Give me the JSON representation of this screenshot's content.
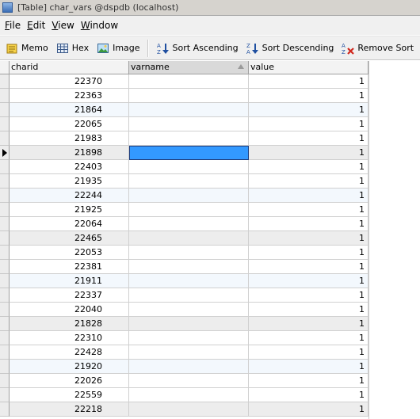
{
  "window": {
    "title": "[Table] char_vars @dspdb (localhost)"
  },
  "menu": {
    "items": [
      {
        "u": "F",
        "rest": "ile"
      },
      {
        "u": "E",
        "rest": "dit"
      },
      {
        "u": "V",
        "rest": "iew"
      },
      {
        "u": "W",
        "rest": "indow"
      }
    ]
  },
  "toolbar": {
    "memo": "Memo",
    "hex": "Hex",
    "image": "Image",
    "sort_asc": "Sort Ascending",
    "sort_desc": "Sort Descending",
    "remove_sort": "Remove Sort"
  },
  "table": {
    "columns": [
      "charid",
      "varname",
      "value"
    ],
    "sorted_column": "varname",
    "rows": [
      {
        "charid": "22370",
        "varname": "",
        "value": "1"
      },
      {
        "charid": "22363",
        "varname": "",
        "value": "1"
      },
      {
        "charid": "21864",
        "varname": "",
        "value": "1"
      },
      {
        "charid": "22065",
        "varname": "",
        "value": "1"
      },
      {
        "charid": "21983",
        "varname": "",
        "value": "1"
      },
      {
        "charid": "21898",
        "varname": "",
        "value": "1"
      },
      {
        "charid": "22403",
        "varname": "",
        "value": "1"
      },
      {
        "charid": "21935",
        "varname": "",
        "value": "1"
      },
      {
        "charid": "22244",
        "varname": "",
        "value": "1"
      },
      {
        "charid": "21925",
        "varname": "",
        "value": "1"
      },
      {
        "charid": "22064",
        "varname": "",
        "value": "1"
      },
      {
        "charid": "22465",
        "varname": "",
        "value": "1"
      },
      {
        "charid": "22053",
        "varname": "",
        "value": "1"
      },
      {
        "charid": "22381",
        "varname": "",
        "value": "1"
      },
      {
        "charid": "21911",
        "varname": "",
        "value": "1"
      },
      {
        "charid": "22337",
        "varname": "",
        "value": "1"
      },
      {
        "charid": "22040",
        "varname": "",
        "value": "1"
      },
      {
        "charid": "21828",
        "varname": "",
        "value": "1"
      },
      {
        "charid": "22310",
        "varname": "",
        "value": "1"
      },
      {
        "charid": "22428",
        "varname": "",
        "value": "1"
      },
      {
        "charid": "21920",
        "varname": "",
        "value": "1"
      },
      {
        "charid": "22026",
        "varname": "",
        "value": "1"
      },
      {
        "charid": "22559",
        "varname": "",
        "value": "1"
      },
      {
        "charid": "22218",
        "varname": "",
        "value": "1"
      }
    ],
    "active_row": 5,
    "selected_column": "varname"
  },
  "colors": {
    "selection": "#3399ff",
    "alt_row": "#f3f8fd",
    "gray_row": "#ededed"
  }
}
